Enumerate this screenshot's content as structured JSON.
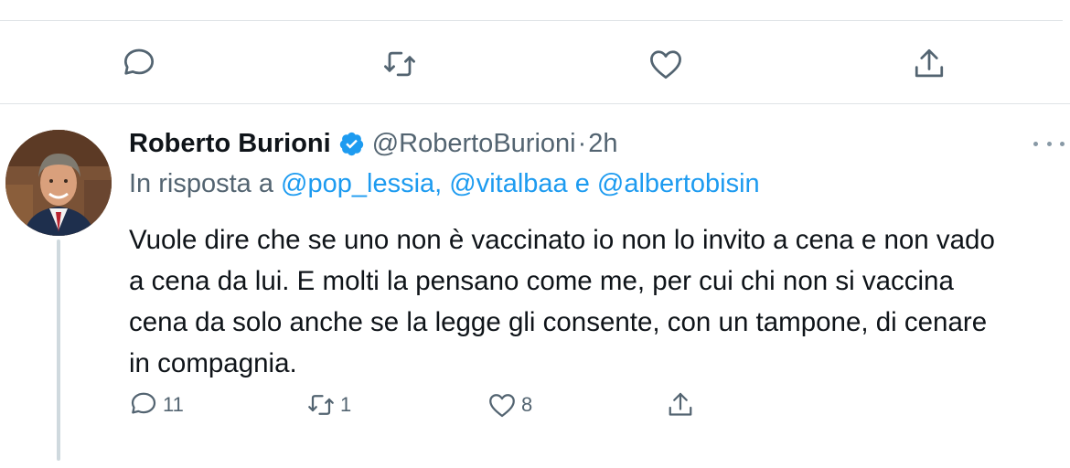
{
  "top_actions": [
    {
      "icon": "reply-icon"
    },
    {
      "icon": "retweet-icon"
    },
    {
      "icon": "like-icon"
    },
    {
      "icon": "share-icon"
    }
  ],
  "tweet": {
    "author_name": "Roberto Burioni",
    "verified": true,
    "handle": "@RobertoBurioni",
    "separator": "·",
    "time": "2h",
    "reply_prefix": "In risposta a",
    "reply_mentions": "@pop_lessia, @vitalbaa e @albertobisin",
    "text_lines": [
      "Vuole dire che se uno non è vaccinato io non lo invito a cena e non vado",
      "a cena da lui. E molti la pensano come me, per cui chi non si vaccina",
      "cena da solo anche se la legge gli consente, con un tampone, di cenare",
      "in compagnia."
    ],
    "stats": {
      "replies": "11",
      "retweets": "1",
      "likes": "8"
    }
  },
  "colors": {
    "accent": "#1d9bf0",
    "secondary_text": "#536471",
    "primary_text": "#0f1419",
    "divider": "#dfe3e6"
  }
}
